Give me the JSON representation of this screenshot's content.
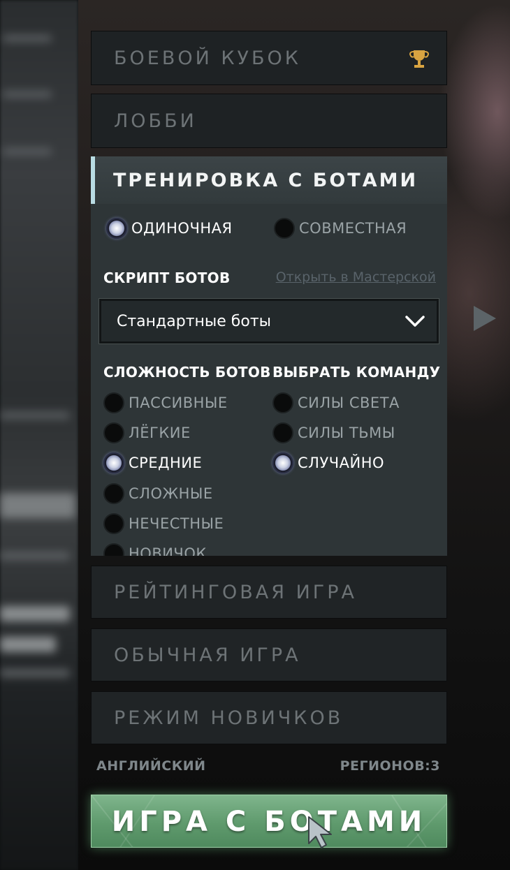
{
  "modes": {
    "battle_cup": "БОЕВОЙ КУБОК",
    "lobby": "ЛОББИ",
    "ranked": "РЕЙТИНГОВАЯ ИГРА",
    "normal": "ОБЫЧНАЯ ИГРА",
    "newbie": "РЕЖИМ НОВИЧКОВ"
  },
  "bot_practice": {
    "title": "ТРЕНИРОВКА С БОТАМИ",
    "play_type": {
      "options": [
        "ОДИНОЧНАЯ",
        "СОВМЕСТНАЯ"
      ],
      "selected": "ОДИНОЧНАЯ"
    },
    "script_label": "СКРИПТ БОТОВ",
    "workshop_link": "Открыть в Мастерской",
    "script_value": "Стандартные боты",
    "difficulty_label": "СЛОЖНОСТЬ БОТОВ",
    "difficulty_options": [
      "ПАССИВНЫЕ",
      "ЛЁГКИЕ",
      "СРЕДНИЕ",
      "СЛОЖНЫЕ",
      "НЕЧЕСТНЫЕ",
      "НОВИЧОК"
    ],
    "difficulty_selected": "СРЕДНИЕ",
    "team_label": "ВЫБРАТЬ КОМАНДУ",
    "team_options": [
      "СИЛЫ СВЕТА",
      "СИЛЫ ТЬМЫ",
      "СЛУЧАЙНО"
    ],
    "team_selected": "СЛУЧАЙНО"
  },
  "footer": {
    "language": "АНГЛИЙСКИЙ",
    "regions": "РЕГИОНОВ:3",
    "play_button": "ИГРА С БОТАМИ"
  },
  "colors": {
    "accent_selected": "#b9dce3",
    "play_green": "#5f9a6d",
    "trophy_gold": "#d9a441"
  },
  "icons": [
    "trophy-icon",
    "chevron-down-icon",
    "right-arrow-icon",
    "cursor-icon"
  ]
}
